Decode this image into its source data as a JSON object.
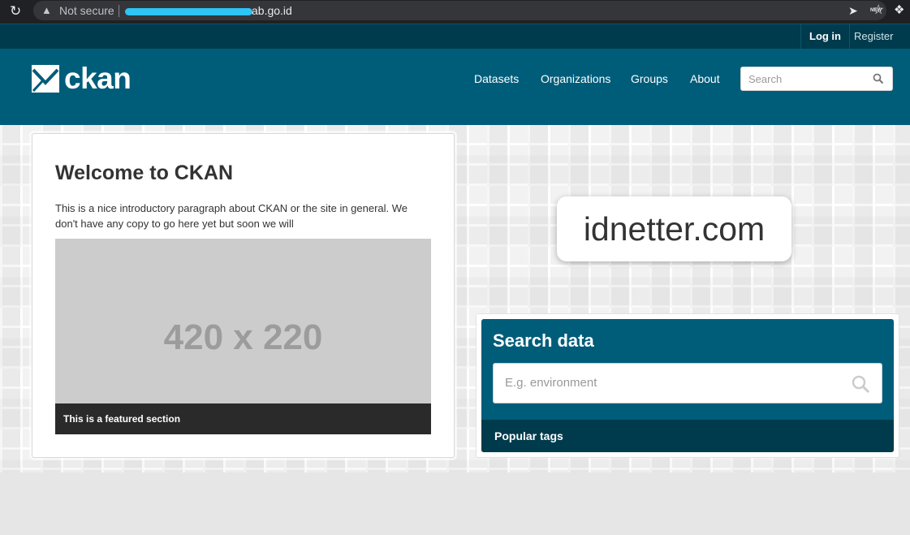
{
  "browser": {
    "reload_icon": "reload-icon",
    "security_label": "Not secure",
    "url_suffix": "ab.go.id",
    "extension_label": "NEW"
  },
  "account": {
    "login_label": "Log in",
    "register_label": "Register"
  },
  "masthead": {
    "logo_text": "ckan",
    "nav": {
      "datasets": "Datasets",
      "organizations": "Organizations",
      "groups": "Groups",
      "about": "About"
    },
    "search_placeholder": "Search"
  },
  "welcome": {
    "title": "Welcome to CKAN",
    "intro": "This is a nice introductory paragraph about CKAN or the site in general. We don't have any copy to go here yet but soon we will",
    "placeholder_image_text": "420 x 220",
    "featured_caption": "This is a featured section"
  },
  "watermark": {
    "text": "idnetter.com"
  },
  "search_data": {
    "title": "Search data",
    "placeholder": "E.g. environment",
    "popular_tags_label": "Popular tags"
  },
  "colors": {
    "brand_primary": "#005d7a",
    "brand_dark": "#003b4d",
    "chrome_bg": "#202124"
  }
}
